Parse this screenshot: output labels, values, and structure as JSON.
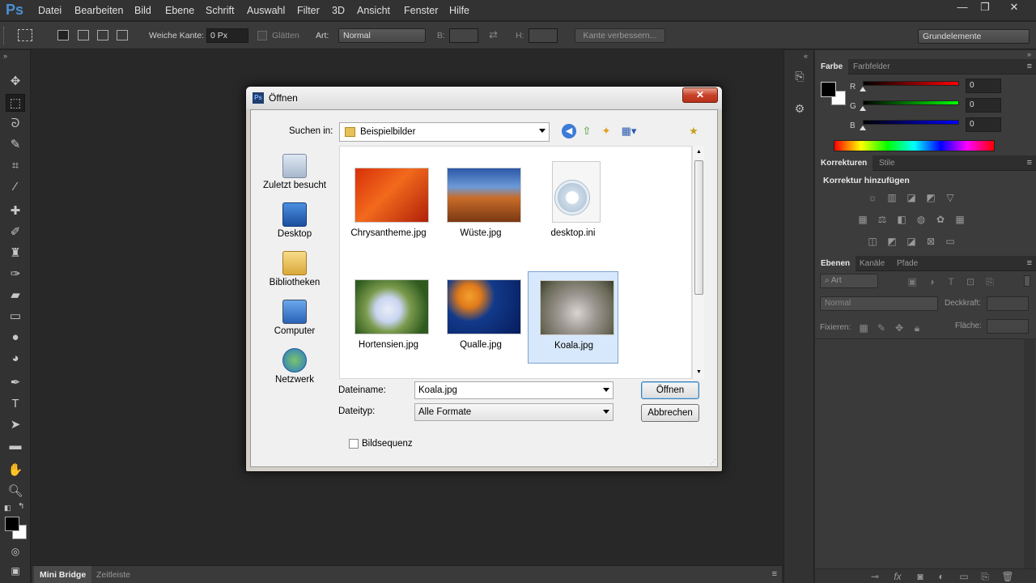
{
  "app": {
    "logo": "Ps"
  },
  "menu": [
    "Datei",
    "Bearbeiten",
    "Bild",
    "Ebene",
    "Schrift",
    "Auswahl",
    "Filter",
    "3D",
    "Ansicht",
    "Fenster",
    "Hilfe"
  ],
  "window_controls": {
    "minimize": "—",
    "restore": "❐",
    "close": "✕"
  },
  "options": {
    "feather_label": "Weiche Kante:",
    "feather_value": "0 Px",
    "antialias_label": "Glätten",
    "style_label": "Art:",
    "style_value": "Normal",
    "width_label": "B:",
    "height_label": "H:",
    "refine_button": "Kante verbessern...",
    "workspace": "Grundelemente"
  },
  "bottom_tabs": [
    "Mini Bridge",
    "Zeitleiste"
  ],
  "panels": {
    "color_tabs": [
      "Farbe",
      "Farbfelder"
    ],
    "rgb": [
      {
        "label": "R",
        "value": "0",
        "color": "#ff0000"
      },
      {
        "label": "G",
        "value": "0",
        "color": "#00ff00"
      },
      {
        "label": "B",
        "value": "0",
        "color": "#0000ff"
      }
    ],
    "adjust_tabs": [
      "Korrekturen",
      "Stile"
    ],
    "adjust_title": "Korrektur hinzufügen",
    "layers_tabs": [
      "Ebenen",
      "Kanäle",
      "Pfade"
    ],
    "layers_filter": "Art",
    "blend_mode": "Normal",
    "opacity_label": "Deckkraft:",
    "lock_label": "Fixieren:",
    "fill_label": "Fläche:"
  },
  "dialog": {
    "title": "Öffnen",
    "look_in_label": "Suchen in:",
    "look_in_value": "Beispielbilder",
    "places": [
      "Zuletzt besucht",
      "Desktop",
      "Bibliotheken",
      "Computer",
      "Netzwerk"
    ],
    "files": [
      {
        "name": "Chrysantheme.jpg",
        "thumb": "linear-gradient(135deg,#d8300a,#f26a1c 45%,#b0200a)"
      },
      {
        "name": "Wüste.jpg",
        "thumb": "linear-gradient(180deg,#2c58a8 0%,#6d9ad6 35%,#c86c2a 55%,#7a3812 100%)"
      },
      {
        "name": "desktop.ini",
        "thumb": "none"
      },
      {
        "name": "Hortensien.jpg",
        "thumb": "radial-gradient(circle at 45% 55%,#e8eef8 0%,#c9d4f0 25%,#7a9a4c 45%,#2e5a1e 80%)"
      },
      {
        "name": "Qualle.jpg",
        "thumb": "radial-gradient(circle at 30% 30%,#f4a030 0%,#e07a1a 18%,#123a8a 40%,#061c5c 100%)"
      },
      {
        "name": "Koala.jpg",
        "thumb": "radial-gradient(circle at 50% 60%,#d8d4d0 0%,#9a948e 40%,#6a6a58 75%,#3a3e2c 100%)"
      }
    ],
    "filename_label": "Dateiname:",
    "filename_value": "Koala.jpg",
    "filetype_label": "Dateityp:",
    "filetype_value": "Alle Formate",
    "open_button": "Öffnen",
    "cancel_button": "Abbrechen",
    "sequence_label": "Bildsequenz"
  }
}
